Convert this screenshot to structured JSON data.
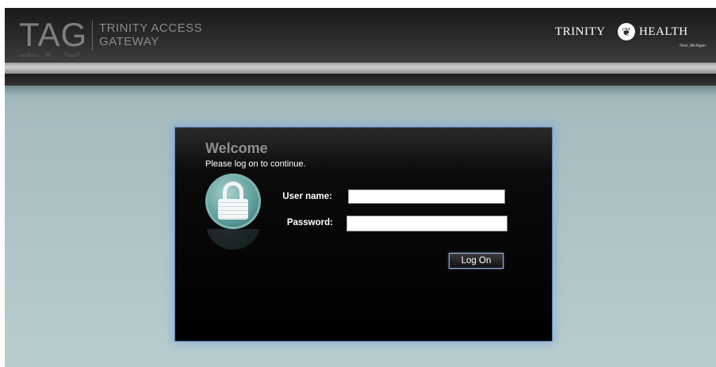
{
  "header": {
    "tag_logo": "TAG",
    "tag_name_line1": "TRINITY ACCESS",
    "tag_name_line2": "GATEWAY",
    "brand_left": "TRINITY",
    "brand_right": "HEALTH",
    "brand_location": "Novi, Michigan"
  },
  "login": {
    "welcome_title": "Welcome",
    "subtitle": "Please log on to continue.",
    "username_label": "User name:",
    "username_value": "",
    "password_label": "Password:",
    "password_value": "",
    "logon_button": "Log On"
  },
  "icons": {
    "lock": "lock-icon",
    "brand": "trinity-health-logo-icon"
  },
  "colors": {
    "page_bg": "#a6bcbf",
    "header_bg": "#2b2b2b",
    "panel_bg": "#000000",
    "panel_border": "#5b7fb4",
    "lock_teal": "#5f9e9c"
  }
}
